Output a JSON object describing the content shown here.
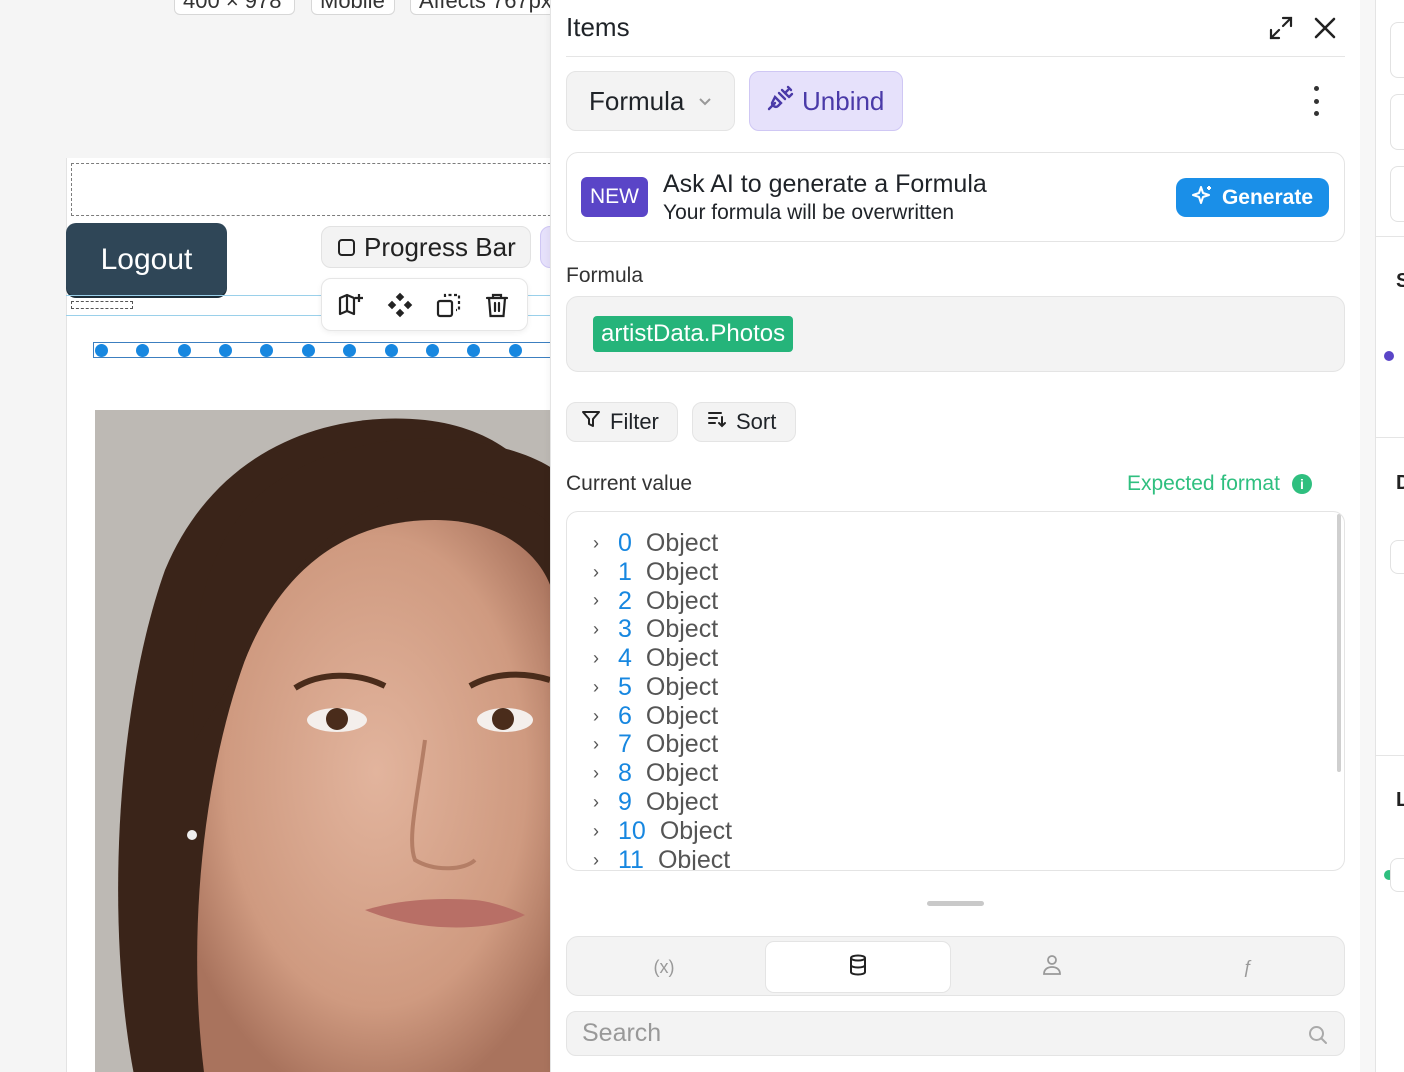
{
  "canvas": {
    "top_chips": [
      "400 × 978",
      "Mobile",
      "Affects 767px"
    ],
    "logout_label": "Logout",
    "progress_bar_label": "Progress Bar",
    "toolbar_icons": [
      "add-element-icon",
      "move-icon",
      "duplicate-icon",
      "trash-icon"
    ],
    "dot_count": 11,
    "photo_alt": "portrait-photo"
  },
  "panel": {
    "title": "Items",
    "formula_select": "Formula",
    "unbind_label": "Unbind",
    "ai": {
      "badge": "NEW",
      "title": "Ask AI to generate a Formula",
      "subtitle": "Your formula will be overwritten",
      "generate_label": "Generate"
    },
    "formula_label": "Formula",
    "formula_token": "artistData.Photos",
    "filter_label": "Filter",
    "sort_label": "Sort",
    "current_value_label": "Current value",
    "expected_format_label": "Expected format",
    "current_value_items": [
      {
        "key": "0",
        "value": "Object"
      },
      {
        "key": "1",
        "value": "Object"
      },
      {
        "key": "2",
        "value": "Object"
      },
      {
        "key": "3",
        "value": "Object"
      },
      {
        "key": "4",
        "value": "Object"
      },
      {
        "key": "5",
        "value": "Object"
      },
      {
        "key": "6",
        "value": "Object"
      },
      {
        "key": "7",
        "value": "Object"
      },
      {
        "key": "8",
        "value": "Object"
      },
      {
        "key": "9",
        "value": "Object"
      },
      {
        "key": "10",
        "value": "Object"
      },
      {
        "key": "11",
        "value": "Object"
      }
    ],
    "source_tabs": [
      {
        "icon": "variable-icon",
        "glyph": "(x)",
        "active": false
      },
      {
        "icon": "database-icon",
        "glyph": "",
        "active": true
      },
      {
        "icon": "user-icon",
        "glyph": "",
        "active": false
      },
      {
        "icon": "function-icon",
        "glyph": "ƒ",
        "active": false
      }
    ],
    "search_placeholder": "Search"
  },
  "colors": {
    "accent_blue": "#1a8fe8",
    "accent_purple": "#5a45c7",
    "formula_green": "#25b47a",
    "logout_bg": "#2f4657"
  }
}
